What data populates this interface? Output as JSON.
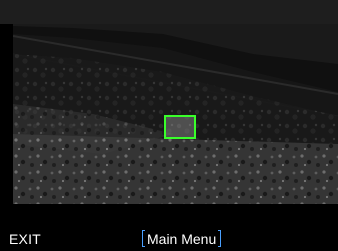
{
  "footer": {
    "exit_label": "EXIT",
    "main_menu_label": "Main Menu"
  },
  "colors": {
    "target_box": "#39ff2a",
    "menu_bracket": "#4aa0ff"
  }
}
